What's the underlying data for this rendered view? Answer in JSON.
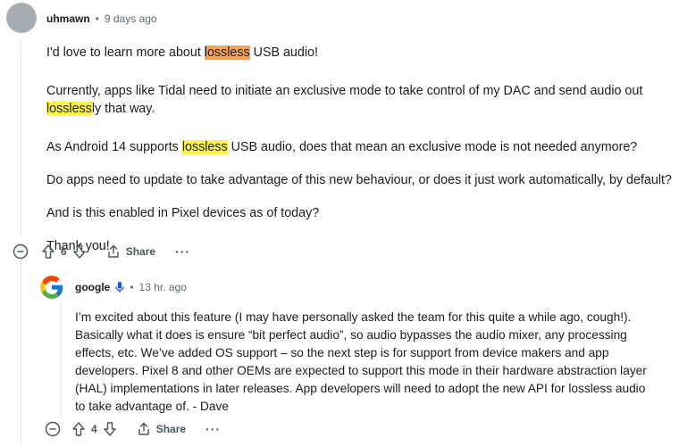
{
  "comment": {
    "author": "uhmawn",
    "separator": "•",
    "time": "9 days ago",
    "p1_before": "I'd love to learn more about ",
    "p1_hl": "lossless",
    "p1_after": " USB audio!",
    "p2_line1": "Currently, apps like Tidal need to initiate an exclusive mode to take control of my DAC and send audio out",
    "p2_hl": "lossless",
    "p2_after": "ly that way.",
    "p3_before": "As Android 14 supports ",
    "p3_hl": "lossless",
    "p3_after": " USB audio, does that mean an exclusive mode is not needed anymore?",
    "p4": "Do apps need to update to take advantage of this new behaviour, or does it just work automatically, by default?",
    "p5": "And is this enabled in Pixel devices as of today?",
    "p6": "Thank you!",
    "votes": "6",
    "share_label": "Share",
    "more_label": "···"
  },
  "reply": {
    "author": "google",
    "separator": "•",
    "time": "13 hr. ago",
    "lines": [
      "I’m excited about this feature (I may have personally asked the team for this quite a while ago, cough!).",
      "Basically what it does is ensure “bit perfect audio”, so audio bypasses the audio mixer, any processing",
      "effects, etc. We’ve added OS support – so the next step is for support from device makers and app",
      "developers. Pixel 8 and other OEMs are expected to support this mode in their hardware abstraction layer",
      "(HAL) implementations in later releases. App developers will need to adopt the new API for lossless audio",
      "to take advantage of. - Dave"
    ],
    "votes": "4",
    "share_label": "Share",
    "more_label": "···"
  },
  "colors": {
    "highlight_orange": "#f4a259",
    "highlight_yellow": "#fff34a",
    "meta_gray": "#5f6b73",
    "avatar_gray": "#a8adb3"
  },
  "icons": [
    "collapse-icon",
    "upvote-icon",
    "downvote-icon",
    "share-icon",
    "more-icon",
    "google-logo",
    "microphone-icon"
  ]
}
